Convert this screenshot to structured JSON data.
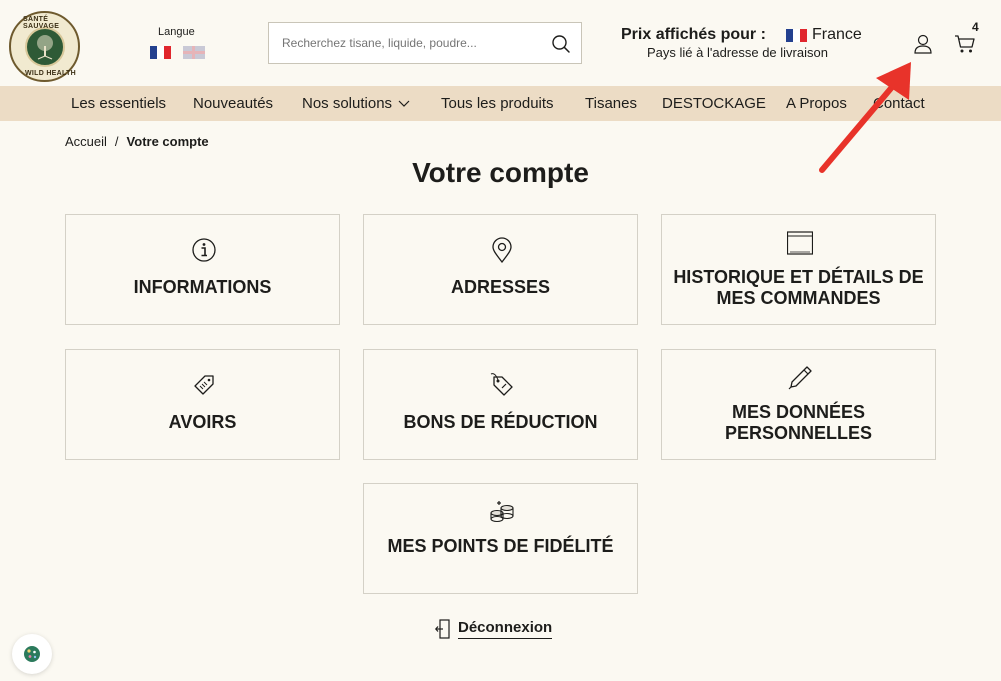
{
  "header": {
    "logo_text_top": "SANTÉ SAUVAGE",
    "logo_text_bottom": "WILD HEALTH",
    "lang_label": "Langue",
    "search_placeholder": "Recherchez tisane, liquide, poudre...",
    "price_label": "Prix affichés pour :",
    "price_country": "France",
    "price_sub": "Pays lié à l'adresse de livraison",
    "cart_count": "4"
  },
  "nav": {
    "items": [
      {
        "label": "Les essentiels"
      },
      {
        "label": "Nouveautés"
      },
      {
        "label": "Nos solutions"
      },
      {
        "label": "Tous les produits"
      },
      {
        "label": "Tisanes"
      },
      {
        "label": "DESTOCKAGE"
      },
      {
        "label": "A Propos"
      },
      {
        "label": "Contact"
      }
    ]
  },
  "breadcrumb": {
    "home": "Accueil",
    "separator": "/",
    "current": "Votre compte"
  },
  "page_title": "Votre compte",
  "cards": [
    {
      "label": "INFORMATIONS",
      "icon": "info-icon"
    },
    {
      "label": "ADRESSES",
      "icon": "location-pin-icon"
    },
    {
      "label": "HISTORIQUE ET DÉTAILS DE MES COMMANDES",
      "icon": "order-history-icon"
    },
    {
      "label": "AVOIRS",
      "icon": "credit-slip-icon"
    },
    {
      "label": "BONS DE RÉDUCTION",
      "icon": "voucher-tag-icon"
    },
    {
      "label": "MES DONNÉES PERSONNELLES",
      "icon": "pen-icon"
    },
    {
      "label": "MES POINTS DE FIDÉLITÉ",
      "icon": "loyalty-coins-icon"
    }
  ],
  "logout_label": "Déconnexion",
  "colors": {
    "background": "#fbf9f2",
    "nav_background": "#ecdcc5",
    "annotation_arrow": "#e8332a"
  }
}
